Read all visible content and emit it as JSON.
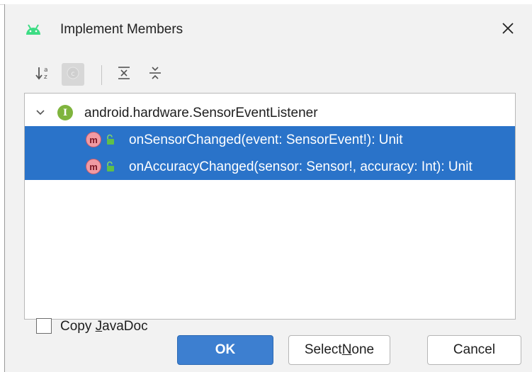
{
  "window": {
    "title": "Implement Members",
    "app_icon": "android-icon",
    "close_icon": "close-icon"
  },
  "toolbar": {
    "sort_icon": "sort-alphabetically-icon",
    "inherited_icon": "show-inherited-icon",
    "expand_icon": "expand-all-icon",
    "collapse_icon": "collapse-all-icon"
  },
  "tree": {
    "interface": {
      "icon_letter": "I",
      "label": "android.hardware.SensorEventListener",
      "expanded": true
    },
    "members": [
      {
        "icon_letter": "m",
        "label": "onSensorChanged(event: SensorEvent!): Unit",
        "selected": true
      },
      {
        "icon_letter": "m",
        "label": "onAccuracyChanged(sensor: Sensor!, accuracy: Int): Unit",
        "selected": true
      }
    ]
  },
  "footer": {
    "copy_javadoc": {
      "label_pre": "Copy ",
      "label_mnemonic": "J",
      "label_post": "avaDoc",
      "checked": false
    },
    "ok_label": "OK",
    "select_none": {
      "label_pre": "Select ",
      "label_mnemonic": "N",
      "label_post": "one"
    },
    "cancel_label": "Cancel"
  },
  "colors": {
    "selection": "#2a73c9",
    "primary_button": "#3d7fd0",
    "interface_icon": "#7fb43d",
    "method_icon": "#f19aa3",
    "android_green": "#3ddc84"
  }
}
